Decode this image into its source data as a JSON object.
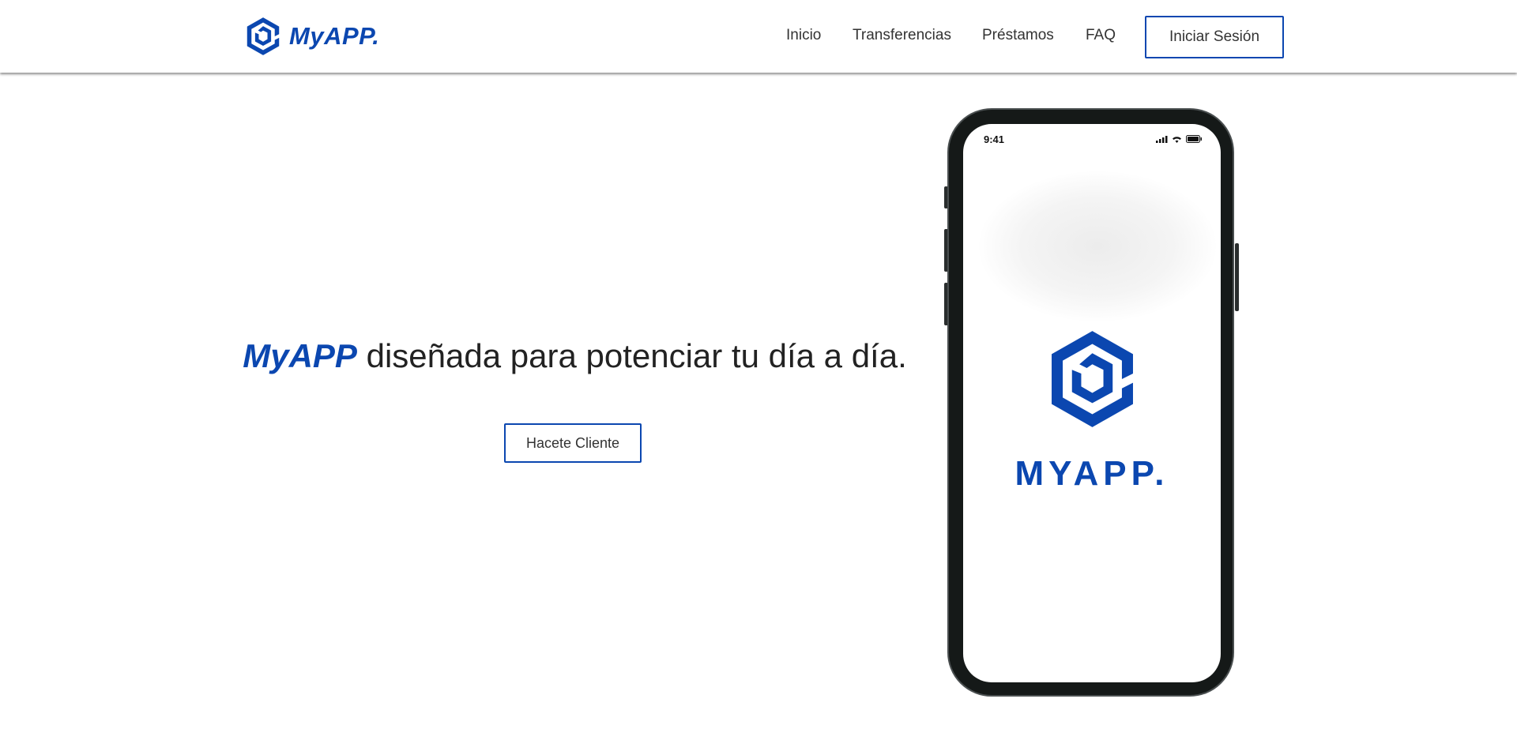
{
  "header": {
    "brand": "MyAPP.",
    "nav": [
      "Inicio",
      "Transferencias",
      "Préstamos",
      "FAQ"
    ],
    "login_label": "Iniciar Sesión"
  },
  "hero": {
    "brand_word": "MyAPP",
    "title_rest": " diseñada para potenciar tu día a día.",
    "cta_label": "Hacete Cliente"
  },
  "phone": {
    "time": "9:41",
    "wordmark": "MYAPP."
  },
  "colors": {
    "accent": "#0b47b0"
  }
}
